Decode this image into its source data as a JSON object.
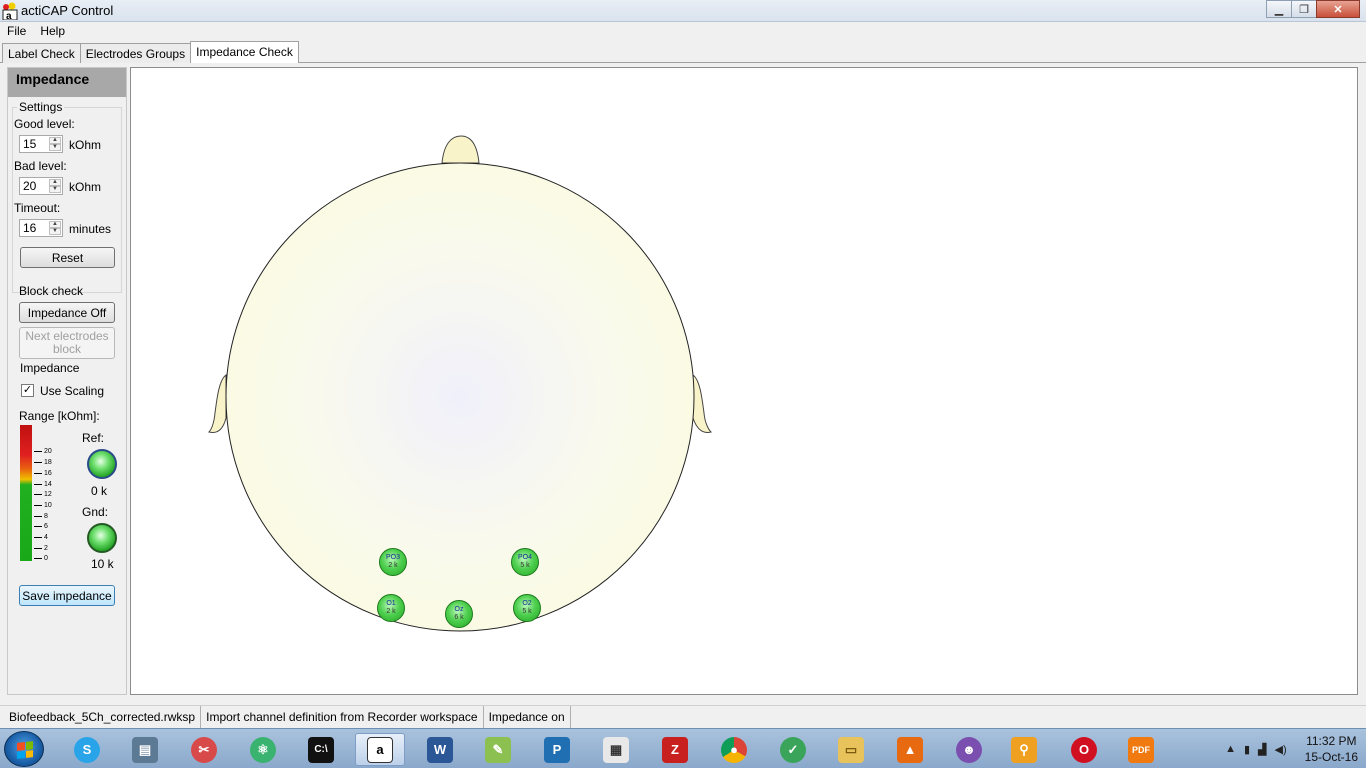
{
  "window": {
    "title": "actiCAP Control"
  },
  "menu": {
    "items": [
      "File",
      "Help"
    ]
  },
  "tabs": [
    "Label Check",
    "Electrodes Groups",
    "Impedance Check"
  ],
  "panel": {
    "title": "Impedance",
    "settings": {
      "group_label": "Settings",
      "good_level_label": "Good level:",
      "good_level_value": "15",
      "bad_level_label": "Bad level:",
      "bad_level_value": "20",
      "timeout_label": "Timeout:",
      "timeout_value": "16",
      "unit_kohm": "kOhm",
      "unit_minutes": "minutes",
      "reset_label": "Reset"
    },
    "block_check": {
      "group_label": "Block check",
      "impedance_off_label": "Impedance Off",
      "next_block_label": "Next electrodes block"
    },
    "impedance": {
      "group_label": "Impedance",
      "use_scaling_label": "Use Scaling",
      "use_scaling_checked": "✓",
      "range_label": "Range [kOhm]:",
      "ticks": [
        "20",
        "18",
        "16",
        "14",
        "12",
        "10",
        "8",
        "6",
        "4",
        "2",
        "0"
      ],
      "ref_label": "Ref:",
      "ref_value": "0 k",
      "gnd_label": "Gnd:",
      "gnd_value": "10 k"
    },
    "save_label": "Save impedance"
  },
  "electrodes": [
    {
      "name": "PO3",
      "value": "2 k"
    },
    {
      "name": "PO4",
      "value": "5 k"
    },
    {
      "name": "O1",
      "value": "2 k"
    },
    {
      "name": "Oz",
      "value": "6 k"
    },
    {
      "name": "O2",
      "value": "5 k"
    }
  ],
  "status": {
    "file": "Biofeedback_5Ch_corrected.rwksp",
    "message": "Import channel definition from Recorder workspace",
    "state": "Impedance on"
  },
  "taskbar": {
    "time": "11:32 PM",
    "date": "15-Oct-16",
    "icons": [
      "skype-icon",
      "media-icon",
      "snipping-tool-icon",
      "atom-icon",
      "cmd-icon",
      "acticap-icon",
      "word-icon",
      "notepadpp-icon",
      "publisher-icon",
      "calc-icon",
      "filezilla-icon",
      "chrome-icon",
      "checkmark-app-icon",
      "explorer-icon",
      "matlab-icon",
      "github-icon",
      "search-tool-icon",
      "opera-icon",
      "pdf-icon"
    ]
  },
  "colors": {
    "accent": "#3c7fb1",
    "good": "#22a622",
    "bad": "#c01010",
    "head_fill": "#fbfbe6"
  }
}
